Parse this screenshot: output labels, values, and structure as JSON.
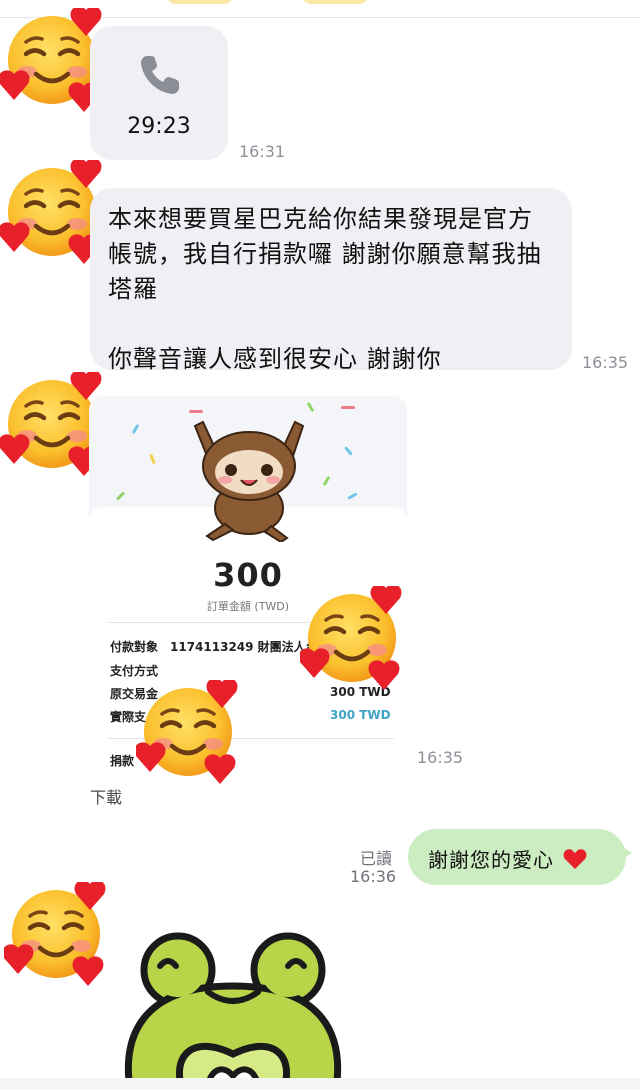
{
  "messages": {
    "call": {
      "duration": "29:23",
      "time": "16:31"
    },
    "text": {
      "lines": [
        "本來想要買星巴克給你結果發現是官方",
        "帳號，我自行捐款囉 謝謝你願意幫我抽",
        "塔羅",
        "",
        "你聲音讓人感到很安心 謝謝你"
      ],
      "time": "16:35"
    },
    "receipt": {
      "amount": "300",
      "amount_label": "訂單金額 (TWD)",
      "rows": [
        {
          "label": "付款對象",
          "value": "1174113249 財團法人台"
        },
        {
          "label": "支付方式",
          "value": ""
        },
        {
          "label": "原交易金",
          "value": "300 TWD"
        },
        {
          "label": "實際支",
          "value": "300 TWD"
        }
      ],
      "footer_label": "捐款",
      "time": "16:35",
      "download": "下載",
      "colors": {
        "highlight_value": "#3fa3c8"
      }
    },
    "reply": {
      "text": "謝謝您的愛心",
      "emoji": "heart",
      "read": "已讀",
      "time": "16:36"
    }
  },
  "colors": {
    "outgoing_bubble": "#ccedc2",
    "incoming_bubble": "#efeff4",
    "timestamp": "#8d919a"
  },
  "icons": [
    "smiling-face-with-hearts-icon",
    "phone-icon",
    "sloth-sticker",
    "frog-sticker",
    "heart-icon"
  ]
}
